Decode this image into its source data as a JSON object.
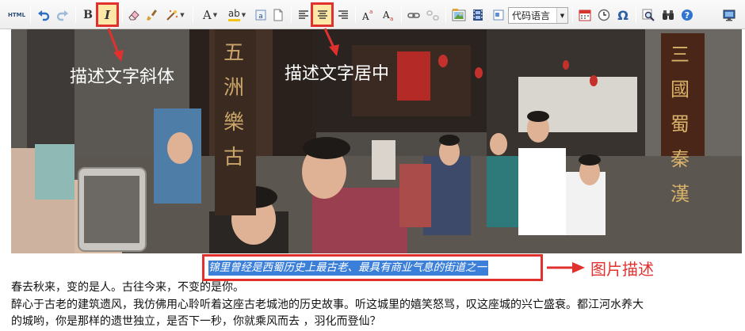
{
  "toolbar": {
    "html_label": "HTML",
    "bold_label": "B",
    "italic_label": "I",
    "font_color_label": "A",
    "highlight_label": "ab",
    "code_language_select": "代码语言",
    "omega_label": "Ω"
  },
  "annotations": {
    "italic_note": "描述文字斜体",
    "center_note": "描述文字居中",
    "caption_note": "图片描述"
  },
  "photo": {
    "sign_left": "五洲樂古",
    "sign_right": "三國蜀秦漢"
  },
  "content": {
    "caption": "锦里曾经是西蜀历史上最古老、最具有商业气息的街道之一",
    "paragraph1": "春去秋来，变的是人。古往今来，不变的是你。",
    "paragraph2_line1": "醉心于古老的建筑遗风，我仿佛用心聆听着这座古老城池的历史故事。听这城里的嬉笑怒骂，叹这座城的兴亡盛衰。都江河水养大",
    "paragraph2_line2": "的城哟，你是那样的遗世独立，是否下一秒，你就乘风而去 ，羽化而登仙？"
  },
  "colors": {
    "annotation_red": "#e0312f",
    "selection_blue": "#3b7fd9",
    "active_button_bg": "#fde8a7"
  }
}
